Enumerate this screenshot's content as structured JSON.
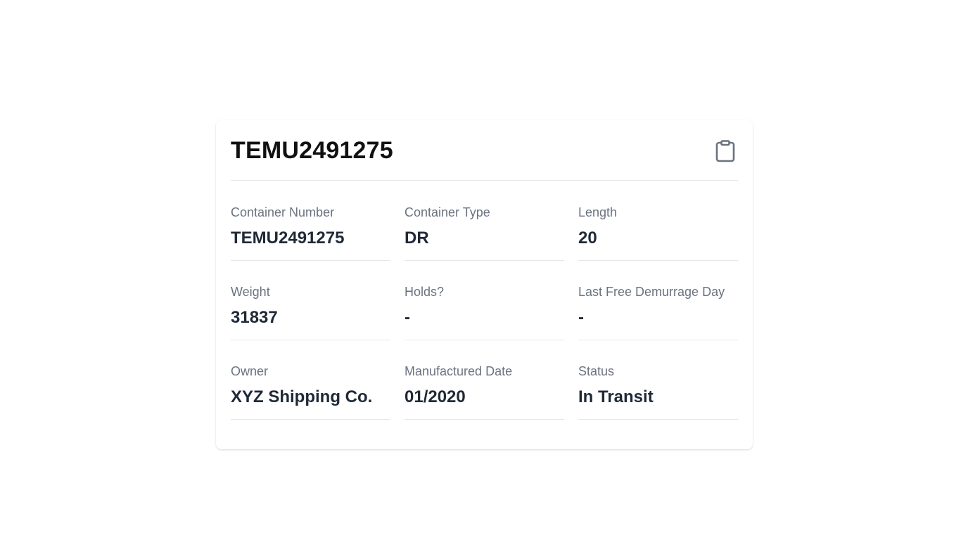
{
  "card": {
    "title": "TEMU2491275",
    "copy_icon": "clipboard-icon"
  },
  "fields": [
    {
      "label": "Container Number",
      "value": "TEMU2491275"
    },
    {
      "label": "Container Type",
      "value": "DR"
    },
    {
      "label": "Length",
      "value": "20"
    },
    {
      "label": "Weight",
      "value": "31837"
    },
    {
      "label": "Holds?",
      "value": "-"
    },
    {
      "label": "Last Free Demurrage Day",
      "value": "-"
    },
    {
      "label": "Owner",
      "value": "XYZ Shipping Co."
    },
    {
      "label": "Manufactured Date",
      "value": "01/2020"
    },
    {
      "label": "Status",
      "value": "In Transit"
    }
  ],
  "colors": {
    "label": "#6b7280",
    "value": "#1f2937",
    "divider": "#e5e7eb",
    "icon": "#6b7280"
  }
}
